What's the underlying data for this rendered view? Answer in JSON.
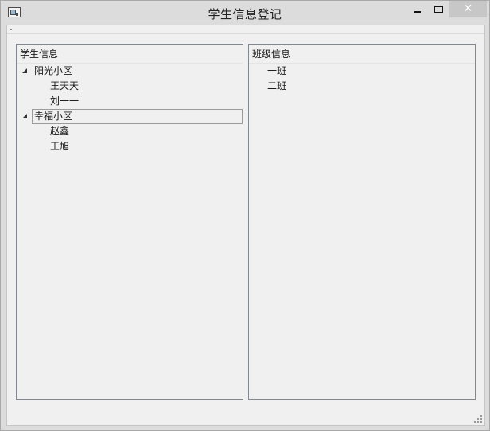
{
  "window": {
    "title": "学生信息登记",
    "close_symbol": "✕",
    "icons": {
      "app": "app-window-icon",
      "minimize": "minimize-icon",
      "maximize": "maximize-icon",
      "close": "close-icon",
      "expand": "expanded-triangle-icon",
      "grip": "size-grip-icon"
    }
  },
  "left_panel": {
    "header": "学生信息",
    "groups": [
      {
        "label": "阳光小区",
        "children": [
          "王天天",
          "刘一一"
        ]
      },
      {
        "label": "幸福小区",
        "selected": true,
        "children": [
          "赵鑫",
          "王旭"
        ]
      }
    ]
  },
  "right_panel": {
    "header": "班级信息",
    "items": [
      "一班",
      "二班"
    ]
  },
  "colors": {
    "window_background": "#dcdcdc",
    "client_background": "#f0f0f0",
    "panel_border": "#828790"
  }
}
